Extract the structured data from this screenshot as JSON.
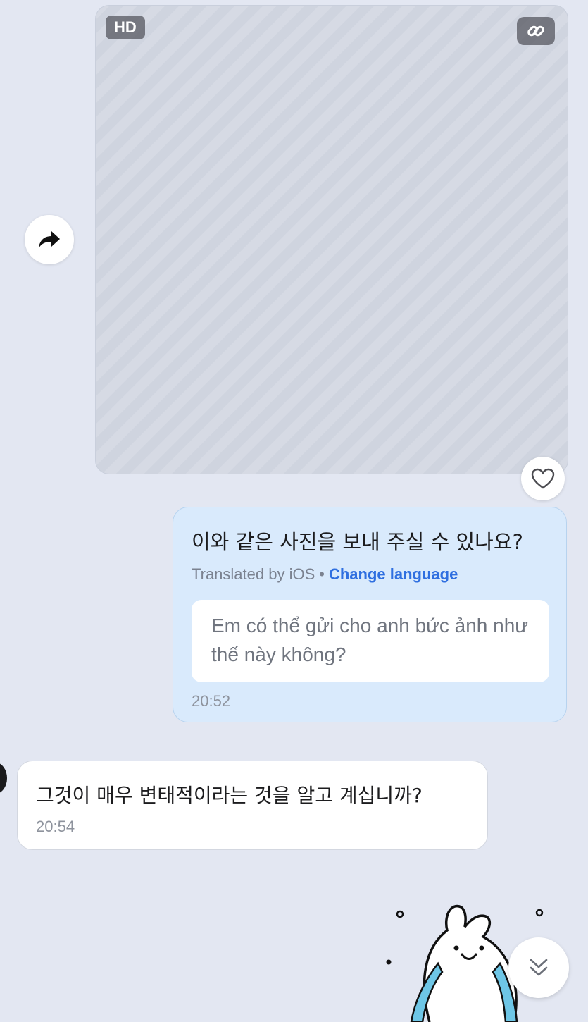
{
  "image_message": {
    "quality_badge": "HD",
    "share_icon": "share-arrow-icon",
    "link_icon": "link-icon",
    "reaction_icon": "heart-outline-icon"
  },
  "outgoing_message": {
    "text": "이와 같은 사진을 보내 주실 수 있나요?",
    "translated_by": "Translated by iOS",
    "separator": "•",
    "change_language": "Change language",
    "translation": "Em có thể gửi cho anh bức ảnh như thế này không?",
    "time": "20:52",
    "bubble_color": "#d9eafc"
  },
  "incoming_message": {
    "text": "그것이 매우 변태적이라는 것을 알고 계십니까?",
    "time": "20:54",
    "bubble_color": "#ffffff"
  },
  "scroll_down_icon": "double-chevron-down-icon",
  "colors": {
    "background": "#e3e7f2",
    "accent": "#2f6fe0"
  }
}
